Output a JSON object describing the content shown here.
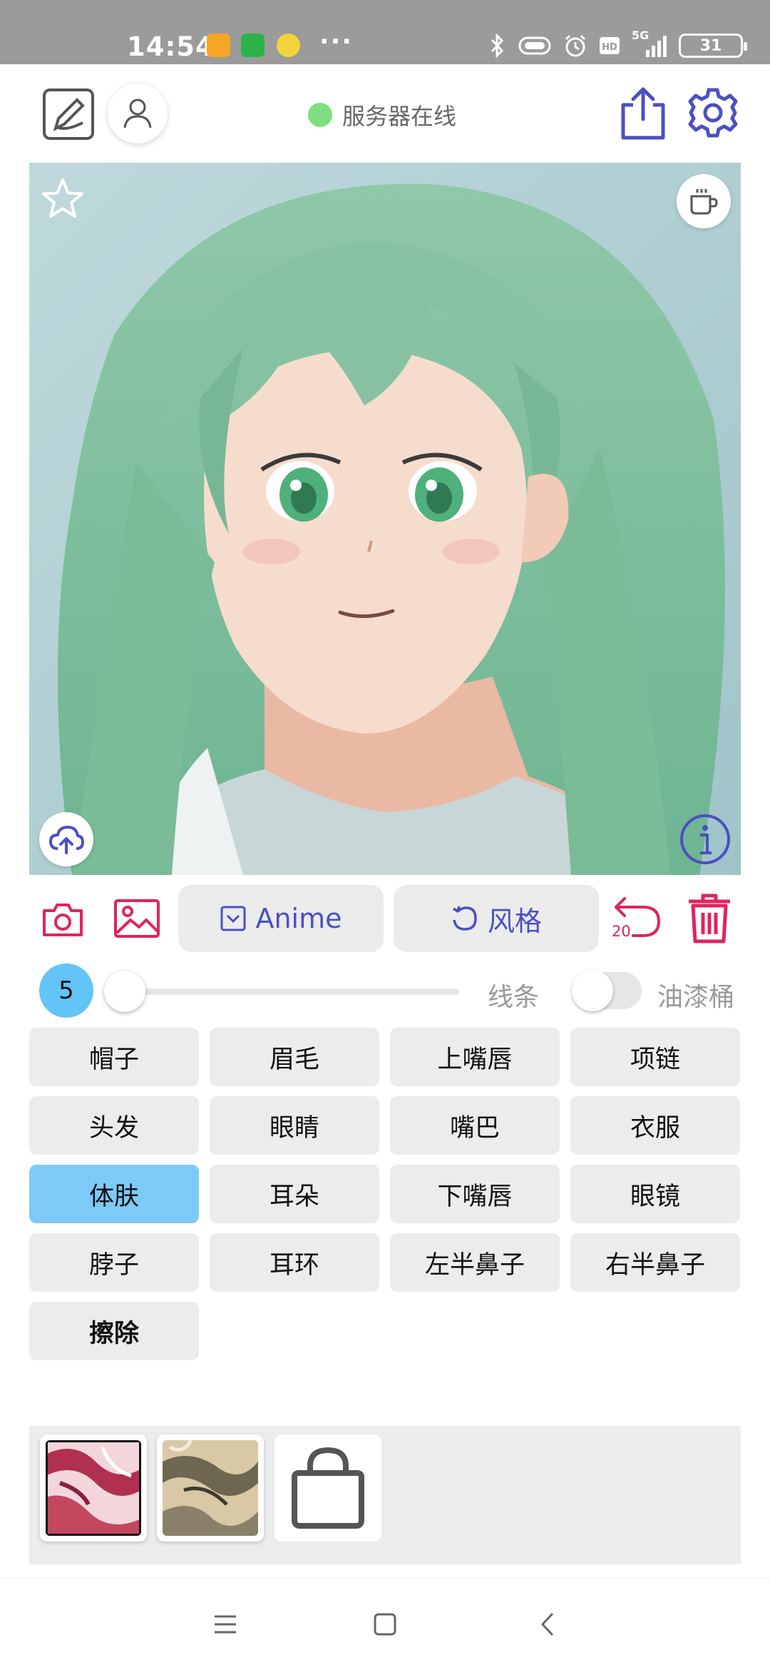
{
  "status_bar": {
    "time": "14:54",
    "signal_label": "5G",
    "battery": "31",
    "more_glyph": "···",
    "app_icons": [
      "notes-app-icon",
      "iqiyi-app-icon",
      "leaf-app-icon"
    ],
    "indicator_icons": [
      "bluetooth-icon",
      "vibrate-icon",
      "alarm-icon",
      "hd-icon",
      "signal-icon",
      "battery-icon"
    ]
  },
  "header": {
    "server_status": "服务器在线",
    "status_color": "#7ddf82",
    "icons": [
      "sketch-mode-icon",
      "user-icon",
      "share-icon",
      "gear-icon"
    ]
  },
  "canvas": {
    "description_icons": [
      "star-icon",
      "coffee-cup-icon",
      "cloud-upload-icon",
      "info-icon"
    ]
  },
  "toolbar": {
    "model_label": "Anime",
    "style_label": "风格",
    "undo_count": "20",
    "accent_color": "#4c4fc3",
    "danger_color": "#e0245e"
  },
  "brush": {
    "size": "5",
    "slider_value": 0,
    "line_label": "线条",
    "line_toggle_on": false,
    "bucket_label": "油漆桶"
  },
  "labels": [
    {
      "text": "帽子",
      "active": false
    },
    {
      "text": "眉毛",
      "active": false
    },
    {
      "text": "上嘴唇",
      "active": false
    },
    {
      "text": "项链",
      "active": false
    },
    {
      "text": "头发",
      "active": false
    },
    {
      "text": "眼睛",
      "active": false
    },
    {
      "text": "嘴巴",
      "active": false
    },
    {
      "text": "衣服",
      "active": false
    },
    {
      "text": "体肤",
      "active": true
    },
    {
      "text": "耳朵",
      "active": false
    },
    {
      "text": "下嘴唇",
      "active": false
    },
    {
      "text": "眼镜",
      "active": false
    },
    {
      "text": "脖子",
      "active": false
    },
    {
      "text": "耳环",
      "active": false
    },
    {
      "text": "左半鼻子",
      "active": false
    },
    {
      "text": "右半鼻子",
      "active": false
    },
    {
      "text": "擦除",
      "active": false
    }
  ],
  "palette": {
    "swatches": [
      "red-texture-swatch",
      "beige-texture-swatch"
    ],
    "shop_icon": "shopping-bag-icon"
  },
  "nav": {
    "icons": [
      "menu-icon",
      "home-icon",
      "back-icon"
    ]
  }
}
